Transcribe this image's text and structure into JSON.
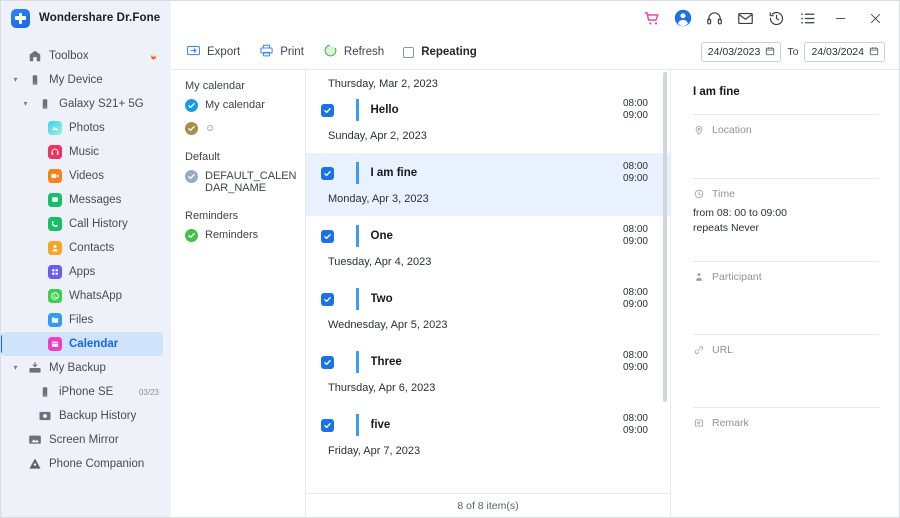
{
  "window": {
    "brand_title": "Wondershare Dr.Fone",
    "logo_icon": "plus-badge-icon",
    "titlebar_icons": [
      {
        "name": "cart-icon",
        "color": "#ff2d9b"
      },
      {
        "name": "account-icon",
        "color": "#1b71e8"
      },
      {
        "name": "headset-icon",
        "color": "#3a4047"
      },
      {
        "name": "mail-icon",
        "color": "#3a4047"
      },
      {
        "name": "history-icon",
        "color": "#3a4047"
      },
      {
        "name": "menu-list-icon",
        "color": "#3a4047"
      }
    ],
    "minimize_label": "─",
    "close_label": "✕"
  },
  "sidebar": {
    "items": [
      {
        "label": "Toolbox",
        "icon": "toolbox-icon",
        "level": 1,
        "caret": "",
        "badge": "",
        "fire": true,
        "selected": false
      },
      {
        "label": "My Device",
        "icon": "device-icon",
        "level": 1,
        "caret": "⌄",
        "badge": "",
        "fire": false,
        "selected": false
      },
      {
        "label": "Galaxy S21+ 5G",
        "icon": "phone-icon",
        "level": 2,
        "caret": "⌄",
        "badge": "",
        "fire": false,
        "selected": false
      },
      {
        "label": "Photos",
        "icon": "photos-icon",
        "level": 3,
        "caret": "",
        "badge": "",
        "fire": false,
        "selected": false,
        "color": "#2bc2e0"
      },
      {
        "label": "Music",
        "icon": "music-icon",
        "level": 3,
        "caret": "",
        "badge": "",
        "fire": false,
        "selected": false,
        "color": "#f0335e"
      },
      {
        "label": "Videos",
        "icon": "videos-icon",
        "level": 3,
        "caret": "",
        "badge": "",
        "fire": false,
        "selected": false,
        "color": "#fa8118"
      },
      {
        "label": "Messages",
        "icon": "messages-icon",
        "level": 3,
        "caret": "",
        "badge": "",
        "fire": false,
        "selected": false,
        "color": "#14c06a"
      },
      {
        "label": "Call History",
        "icon": "call-history-icon",
        "level": 3,
        "caret": "",
        "badge": "",
        "fire": false,
        "selected": false,
        "color": "#15c064"
      },
      {
        "label": "Contacts",
        "icon": "contacts-icon",
        "level": 3,
        "caret": "",
        "badge": "",
        "fire": false,
        "selected": false,
        "color": "#f4a62a"
      },
      {
        "label": "Apps",
        "icon": "apps-icon",
        "level": 3,
        "caret": "",
        "badge": "",
        "fire": false,
        "selected": false,
        "color": "#6a5df0"
      },
      {
        "label": "WhatsApp",
        "icon": "whatsapp-icon",
        "level": 3,
        "caret": "",
        "badge": "",
        "fire": false,
        "selected": false,
        "color": "#3ed14f"
      },
      {
        "label": "Files",
        "icon": "files-icon",
        "level": 3,
        "caret": "",
        "badge": "",
        "fire": false,
        "selected": false,
        "color": "#2f9df5"
      },
      {
        "label": "Calendar",
        "icon": "calendar-icon",
        "level": 3,
        "caret": "",
        "badge": "",
        "fire": false,
        "selected": true,
        "color": "#f23cc4"
      },
      {
        "label": "My Backup",
        "icon": "backup-icon",
        "level": 1,
        "caret": "⌄",
        "badge": "",
        "fire": false,
        "selected": false
      },
      {
        "label": "iPhone SE",
        "icon": "phone-icon",
        "level": 2,
        "caret": "",
        "badge": "03/23",
        "fire": false,
        "selected": false
      },
      {
        "label": "Backup History",
        "icon": "backup-history-icon",
        "level": 2,
        "caret": "",
        "badge": "",
        "fire": false,
        "selected": false
      },
      {
        "label": "Screen Mirror",
        "icon": "screen-mirror-icon",
        "level": 1,
        "caret": "",
        "badge": "",
        "fire": false,
        "selected": false
      },
      {
        "label": "Phone Companion",
        "icon": "phone-companion-icon",
        "level": 1,
        "caret": "",
        "badge": "",
        "fire": false,
        "selected": false
      }
    ]
  },
  "toolbar": {
    "export_label": "Export",
    "print_label": "Print",
    "refresh_label": "Refresh",
    "repeating_label": "Repeating",
    "repeating_checked": false,
    "date_from": "24/03/2023",
    "date_to": "24/03/2024",
    "to_label": "To"
  },
  "calendar_list": {
    "groups": [
      {
        "title": "My calendar",
        "items": [
          {
            "label": "My calendar",
            "checked": true,
            "color": "#1b9ae8",
            "emoji": ""
          },
          {
            "label": "",
            "checked": true,
            "color": "#b08a4a",
            "emoji": "☺"
          }
        ]
      },
      {
        "title": "Default",
        "items": [
          {
            "label": "DEFAULT_CALENDAR_NAME",
            "checked": true,
            "color": "#9aacc0",
            "emoji": ""
          }
        ]
      },
      {
        "title": "Reminders",
        "items": [
          {
            "label": "Reminders",
            "checked": true,
            "color": "#3fc14a",
            "emoji": ""
          }
        ]
      }
    ]
  },
  "events": {
    "lead_date": "Thursday, Mar 2, 2023",
    "items": [
      {
        "title": "Hello",
        "start": "08:00",
        "end": "09:00",
        "date": "Sunday, Apr 2, 2023",
        "checked": true,
        "selected": false
      },
      {
        "title": "I am fine",
        "start": "08:00",
        "end": "09:00",
        "date": "Monday, Apr 3, 2023",
        "checked": true,
        "selected": true
      },
      {
        "title": "One",
        "start": "08:00",
        "end": "09:00",
        "date": "Tuesday, Apr 4, 2023",
        "checked": true,
        "selected": false
      },
      {
        "title": "Two",
        "start": "08:00",
        "end": "09:00",
        "date": "Wednesday, Apr 5, 2023",
        "checked": true,
        "selected": false
      },
      {
        "title": "Three",
        "start": "08:00",
        "end": "09:00",
        "date": "Thursday, Apr 6, 2023",
        "checked": true,
        "selected": false
      },
      {
        "title": "five",
        "start": "08:00",
        "end": "09:00",
        "date": "Friday, Apr 7, 2023",
        "checked": true,
        "selected": false
      }
    ],
    "status": "8 of 8 item(s)"
  },
  "detail": {
    "title": "I am fine",
    "location_label": "Location",
    "location_value": "",
    "time_label": "Time",
    "time_value_line1": "from 08: 00 to 09:00",
    "time_value_line2": "repeats Never",
    "participant_label": "Participant",
    "participant_value": "",
    "url_label": "URL",
    "url_value": "",
    "remark_label": "Remark",
    "remark_value": ""
  }
}
